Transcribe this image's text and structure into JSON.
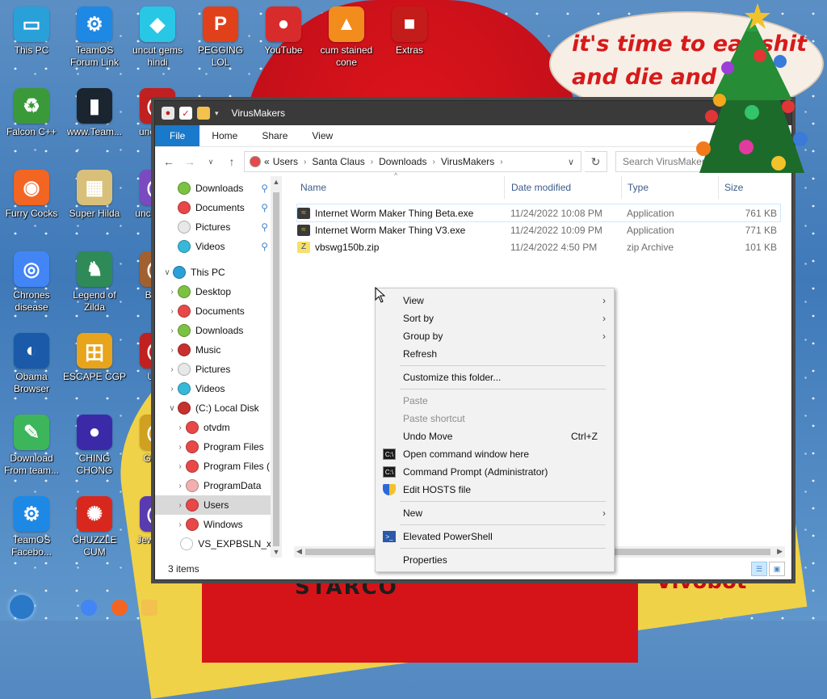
{
  "wallpaper": {
    "bubble_text": "it's time to eat shit and die and go",
    "bottom_right_text": "Vivobot",
    "bottom_mid_text": "STARCO"
  },
  "desktop_icons": [
    {
      "label": "This PC",
      "icon": "monitor-icon",
      "color": "#2aa0d8"
    },
    {
      "label": "TeamOS Forum Link",
      "icon": "gear-icon",
      "color": "#1e88e5"
    },
    {
      "label": "uncut gems hindi",
      "icon": "diamond-icon",
      "color": "#28c7e6"
    },
    {
      "label": "PEGGING LOL",
      "icon": "p-logo-icon",
      "color": "#e0401a"
    },
    {
      "label": "YouTube",
      "icon": "angry-bird-icon",
      "color": "#d82b2b"
    },
    {
      "label": "cum stained cone",
      "icon": "candy-icon",
      "color": "#f28c1c"
    },
    {
      "label": "Extras",
      "icon": "gift-icon",
      "color": "#c41b1b"
    },
    {
      "label": "Falcon C++",
      "icon": "recycle-icon",
      "color": "#3a9a3a"
    },
    {
      "label": "www.Team...",
      "icon": "book-icon",
      "color": "#1b2530"
    },
    {
      "label": "uncut ba",
      "icon": "ring-icon",
      "color": "#c02020"
    },
    {
      "label": "Furry Cocks",
      "icon": "firefox-icon",
      "color": "#f26522"
    },
    {
      "label": "Super Hilda",
      "icon": "pixel-art-icon",
      "color": "#d9c07a"
    },
    {
      "label": "uncu delet",
      "icon": "ring-icon",
      "color": "#7a4ac0"
    },
    {
      "label": "Chrones disease",
      "icon": "chrome-icon",
      "color": "#4285f4"
    },
    {
      "label": "Legend of Zilda",
      "icon": "zelda-icon",
      "color": "#2e8b57"
    },
    {
      "label": "BIIIIG",
      "icon": "ring-icon",
      "color": "#a06030"
    },
    {
      "label": "Obama Browser",
      "icon": "obama-logo-icon",
      "color": "#1a5aa8"
    },
    {
      "label": "ESCAPE CGP",
      "icon": "mahjong-icon",
      "color": "#e8a41a"
    },
    {
      "label": "UKR",
      "icon": "ring-icon",
      "color": "#c02020"
    },
    {
      "label": "Download From team...",
      "icon": "notepad-icon",
      "color": "#3db55a"
    },
    {
      "label": "CHING CHONG",
      "icon": "ornament-icon",
      "color": "#3b2aa8"
    },
    {
      "label": "GENC",
      "icon": "ring-icon",
      "color": "#d0a020"
    },
    {
      "label": "TeamOS Facebo...",
      "icon": "gear-icon",
      "color": "#1e88e5"
    },
    {
      "label": "CHUZZLE CUM",
      "icon": "chuzzle-icon",
      "color": "#d8281e"
    },
    {
      "label": "Jews Palt",
      "icon": "ring-icon",
      "color": "#5a3ab0"
    }
  ],
  "window": {
    "title": "VirusMakers",
    "ribbon_tabs": [
      "File",
      "Home",
      "Share",
      "View"
    ],
    "address": {
      "overflow": "«",
      "crumbs": [
        "Users",
        "Santa Claus",
        "Downloads",
        "VirusMakers"
      ]
    },
    "search_placeholder": "Search VirusMakers",
    "nav_items": [
      {
        "label": "Downloads",
        "indent": 0,
        "expander": "",
        "pinned": true,
        "color": "#7cc242"
      },
      {
        "label": "Documents",
        "indent": 0,
        "expander": "",
        "pinned": true,
        "color": "#e84848"
      },
      {
        "label": "Pictures",
        "indent": 0,
        "expander": "",
        "pinned": true,
        "color": "#e8e8e8"
      },
      {
        "label": "Videos",
        "indent": 0,
        "expander": "",
        "pinned": true,
        "color": "#36b8d8"
      },
      {
        "label": "This PC",
        "indent": 0,
        "expander": "∨",
        "pinned": false,
        "color": "#2aa0d8"
      },
      {
        "label": "Desktop",
        "indent": 1,
        "expander": "›",
        "pinned": false,
        "color": "#7cc242"
      },
      {
        "label": "Documents",
        "indent": 1,
        "expander": "›",
        "pinned": false,
        "color": "#e84848"
      },
      {
        "label": "Downloads",
        "indent": 1,
        "expander": "›",
        "pinned": false,
        "color": "#7cc242"
      },
      {
        "label": "Music",
        "indent": 1,
        "expander": "›",
        "pinned": false,
        "color": "#c83030"
      },
      {
        "label": "Pictures",
        "indent": 1,
        "expander": "›",
        "pinned": false,
        "color": "#e8e8e8"
      },
      {
        "label": "Videos",
        "indent": 1,
        "expander": "›",
        "pinned": false,
        "color": "#36b8d8"
      },
      {
        "label": "(C:) Local Disk",
        "indent": 1,
        "expander": "∨",
        "pinned": false,
        "color": "#c83030"
      },
      {
        "label": "otvdm",
        "indent": 2,
        "expander": "›",
        "pinned": false,
        "color": "#e84848"
      },
      {
        "label": "Program Files",
        "indent": 2,
        "expander": "›",
        "pinned": false,
        "color": "#e84848"
      },
      {
        "label": "Program Files (",
        "indent": 2,
        "expander": "›",
        "pinned": false,
        "color": "#e84848"
      },
      {
        "label": "ProgramData",
        "indent": 2,
        "expander": "›",
        "pinned": false,
        "color": "#f0b0b0"
      },
      {
        "label": "Users",
        "indent": 2,
        "expander": "›",
        "pinned": false,
        "color": "#e84848",
        "selected": true
      },
      {
        "label": "Windows",
        "indent": 2,
        "expander": "›",
        "pinned": false,
        "color": "#e84848"
      },
      {
        "label": "VS_EXPBSLN_x",
        "indent": 2,
        "expander": "",
        "pinned": false,
        "color": "#ffffff"
      }
    ],
    "columns": [
      "Name",
      "Date modified",
      "Type",
      "Size"
    ],
    "files": [
      {
        "name": "Internet Worm Maker Thing Beta.exe",
        "date": "11/24/2022 10:08 PM",
        "type": "Application",
        "size": "761 KB",
        "icon": "worm-exe-icon"
      },
      {
        "name": "Internet Worm Maker Thing V3.exe",
        "date": "11/24/2022 10:09 PM",
        "type": "Application",
        "size": "771 KB",
        "icon": "worm-exe-icon"
      },
      {
        "name": "vbswg150b.zip",
        "date": "11/24/2022 4:50 PM",
        "type": "zip Archive",
        "size": "101 KB",
        "icon": "zip-icon"
      }
    ],
    "status": "3 items"
  },
  "context_menu": [
    {
      "label": "View",
      "submenu": true
    },
    {
      "label": "Sort by",
      "submenu": true
    },
    {
      "label": "Group by",
      "submenu": true
    },
    {
      "label": "Refresh"
    },
    {
      "separator": true
    },
    {
      "label": "Customize this folder..."
    },
    {
      "separator": true
    },
    {
      "label": "Paste",
      "disabled": true
    },
    {
      "label": "Paste shortcut",
      "disabled": true
    },
    {
      "label": "Undo Move",
      "shortcut": "Ctrl+Z"
    },
    {
      "label": "Open command window here",
      "icon": "cmd-icon"
    },
    {
      "label": "Command Prompt (Administrator)",
      "icon": "cmd-icon"
    },
    {
      "label": "Edit HOSTS file",
      "icon": "shield-icon"
    },
    {
      "separator": true
    },
    {
      "label": "New",
      "submenu": true
    },
    {
      "separator": true
    },
    {
      "label": "Elevated PowerShell",
      "icon": "powershell-icon"
    },
    {
      "separator": true
    },
    {
      "label": "Properties"
    }
  ],
  "taskbar": [
    {
      "icon": "start-orb-icon",
      "color": "#2a78c8"
    },
    {
      "icon": "chrome-icon",
      "color": "#4285f4"
    },
    {
      "icon": "firefox-icon",
      "color": "#f26522"
    },
    {
      "icon": "folder-icon",
      "color": "#f2c14e"
    }
  ]
}
